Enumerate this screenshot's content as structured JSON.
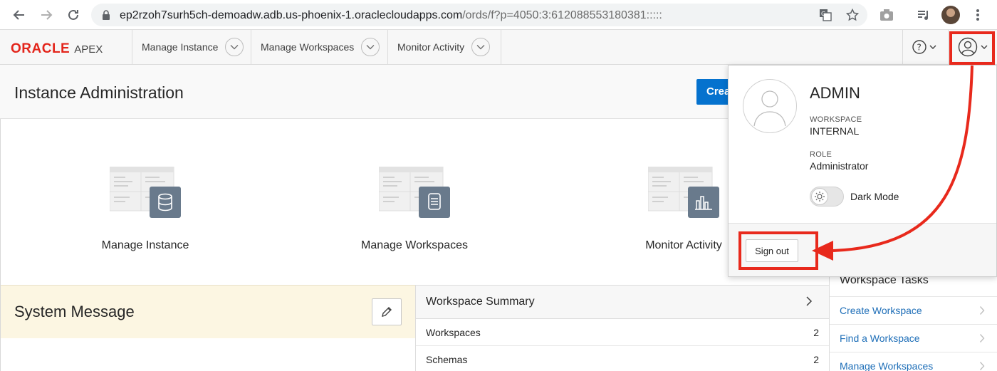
{
  "browser": {
    "url_host": "ep2rzoh7surh5ch-demoadw.adb.us-phoenix-1.oraclecloudapps.com",
    "url_path": "/ords/f?p=4050:3:612088553180381:::::"
  },
  "header": {
    "logo_brand": "ORACLE",
    "logo_product": "APEX",
    "nav": [
      {
        "label": "Manage Instance"
      },
      {
        "label": "Manage Workspaces"
      },
      {
        "label": "Monitor Activity"
      }
    ]
  },
  "title_region": {
    "title": "Instance Administration",
    "create_label": "Create"
  },
  "cards": [
    {
      "label": "Manage Instance",
      "icon": "database-icon"
    },
    {
      "label": "Manage Workspaces",
      "icon": "document-icon"
    },
    {
      "label": "Monitor Activity",
      "icon": "bar-chart-icon"
    }
  ],
  "system_message": {
    "title": "System Message"
  },
  "workspace_summary": {
    "title": "Workspace Summary",
    "rows": [
      {
        "label": "Workspaces",
        "value": "2"
      },
      {
        "label": "Schemas",
        "value": "2"
      }
    ]
  },
  "workspace_tasks": {
    "title": "Workspace Tasks",
    "items": [
      {
        "label": "Create Workspace"
      },
      {
        "label": "Find a Workspace"
      },
      {
        "label": "Manage Workspaces"
      }
    ]
  },
  "user_menu": {
    "name": "ADMIN",
    "workspace_label": "WORKSPACE",
    "workspace_value": "INTERNAL",
    "role_label": "ROLE",
    "role_value": "Administrator",
    "dark_mode_label": "Dark Mode",
    "dark_mode_on": false,
    "sign_out_label": "Sign out"
  },
  "colors": {
    "oracle_red": "#e3251b",
    "annotation_red": "#e8291c",
    "primary_blue": "#0572ce",
    "link_blue": "#1f6fb8",
    "message_bg": "#fcf6e2"
  }
}
